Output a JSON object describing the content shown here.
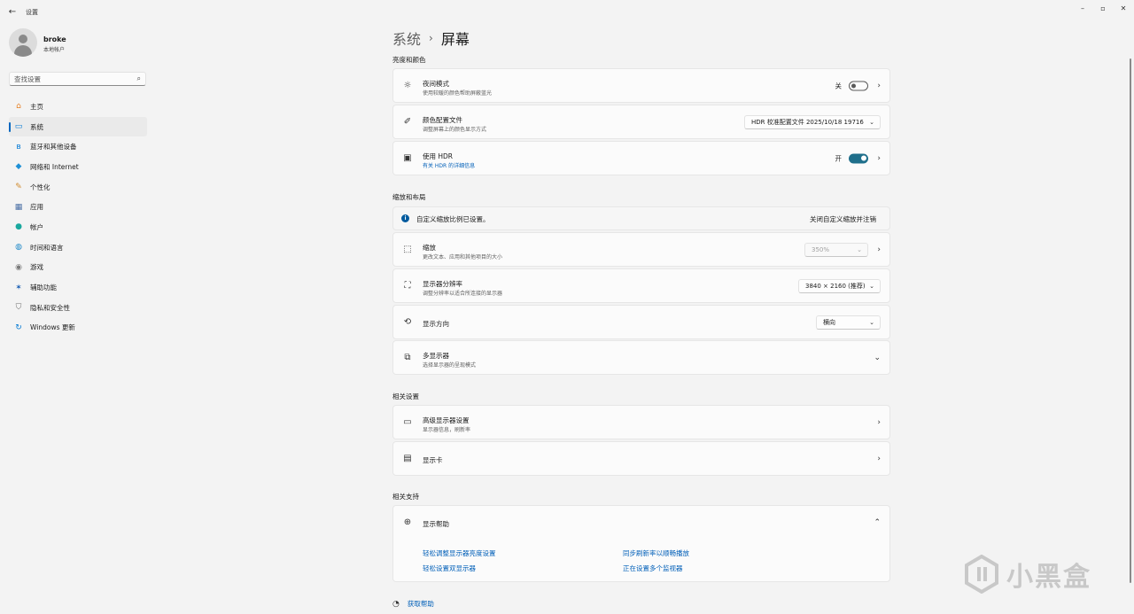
{
  "titlebar": {
    "title": "设置",
    "back_icon": "arrow-left-icon",
    "minimize": "–",
    "maximize": "▫",
    "close": "✕"
  },
  "profile": {
    "name": "broke",
    "account_type": "本地帐户"
  },
  "search": {
    "placeholder": "查找设置",
    "icon": "⌕"
  },
  "nav": {
    "items": [
      {
        "label": "主页",
        "icon": "home-icon",
        "glyph": "⌂",
        "color": "#e67e22"
      },
      {
        "label": "系统",
        "icon": "system-icon",
        "glyph": "▭",
        "color": "#0078d4",
        "active": true
      },
      {
        "label": "蓝牙和其他设备",
        "icon": "bluetooth-icon",
        "glyph": "ʙ",
        "color": "#0078d4"
      },
      {
        "label": "网络和 Internet",
        "icon": "network-icon",
        "glyph": "◆",
        "color": "#1e90d6"
      },
      {
        "label": "个性化",
        "icon": "personalization-icon",
        "glyph": "✎",
        "color": "#d08a2e"
      },
      {
        "label": "应用",
        "icon": "apps-icon",
        "glyph": "▦",
        "color": "#4a6fa5"
      },
      {
        "label": "帐户",
        "icon": "accounts-icon",
        "glyph": "●",
        "color": "#19a89e"
      },
      {
        "label": "时间和语言",
        "icon": "time-language-icon",
        "glyph": "◍",
        "color": "#1e88c8"
      },
      {
        "label": "游戏",
        "icon": "gaming-icon",
        "glyph": "◉",
        "color": "#7a7a7a"
      },
      {
        "label": "辅助功能",
        "icon": "accessibility-icon",
        "glyph": "✶",
        "color": "#1a5fb4"
      },
      {
        "label": "隐私和安全性",
        "icon": "privacy-shield-icon",
        "glyph": "⛉",
        "color": "#6d6d6d"
      },
      {
        "label": "Windows 更新",
        "icon": "windows-update-icon",
        "glyph": "↻",
        "color": "#0078d4"
      }
    ]
  },
  "breadcrumb": {
    "parent": "系统",
    "separator": "›",
    "current": "屏幕"
  },
  "sections": {
    "brightness": "亮度和颜色",
    "scale_layout": "缩放和布局",
    "related_settings": "相关设置",
    "related_support": "相关支持"
  },
  "night_light": {
    "title": "夜间模式",
    "subtitle": "使用较暖的颜色帮助屏蔽蓝光",
    "state_label": "关",
    "on": false
  },
  "color_profile": {
    "title": "颜色配置文件",
    "subtitle": "调整屏幕上的颜色显示方式",
    "value": "HDR 校准配置文件 2025/10/18 19716"
  },
  "hdr": {
    "title": "使用 HDR",
    "subtitle": "有关 HDR 的详细信息",
    "state_label": "开",
    "on": true
  },
  "scale_info": {
    "text": "自定义缩放比例已设置。",
    "link": "关闭自定义缩放并注销"
  },
  "scale": {
    "title": "缩放",
    "subtitle": "更改文本、应用和其他项目的大小",
    "value": "350%"
  },
  "resolution": {
    "title": "显示器分辨率",
    "subtitle": "调整分辨率以适合所连接的显示器",
    "value": "3840 × 2160 (推荐)"
  },
  "orientation": {
    "title": "显示方向",
    "value": "横向"
  },
  "multi_display": {
    "title": "多显示器",
    "subtitle": "选择显示器的呈现模式"
  },
  "advanced_display": {
    "title": "高级显示器设置",
    "subtitle": "显示器信息，刷新率"
  },
  "graphics": {
    "title": "显示卡"
  },
  "display_help": {
    "title": "显示帮助",
    "links": [
      "轻松调整显示器亮度设置",
      "同步刷新率以顺畅播放",
      "轻松设置双显示器",
      "正在设置多个监视器"
    ]
  },
  "get_help": {
    "label": "获取帮助"
  },
  "watermark": {
    "text": "小黑盒"
  }
}
